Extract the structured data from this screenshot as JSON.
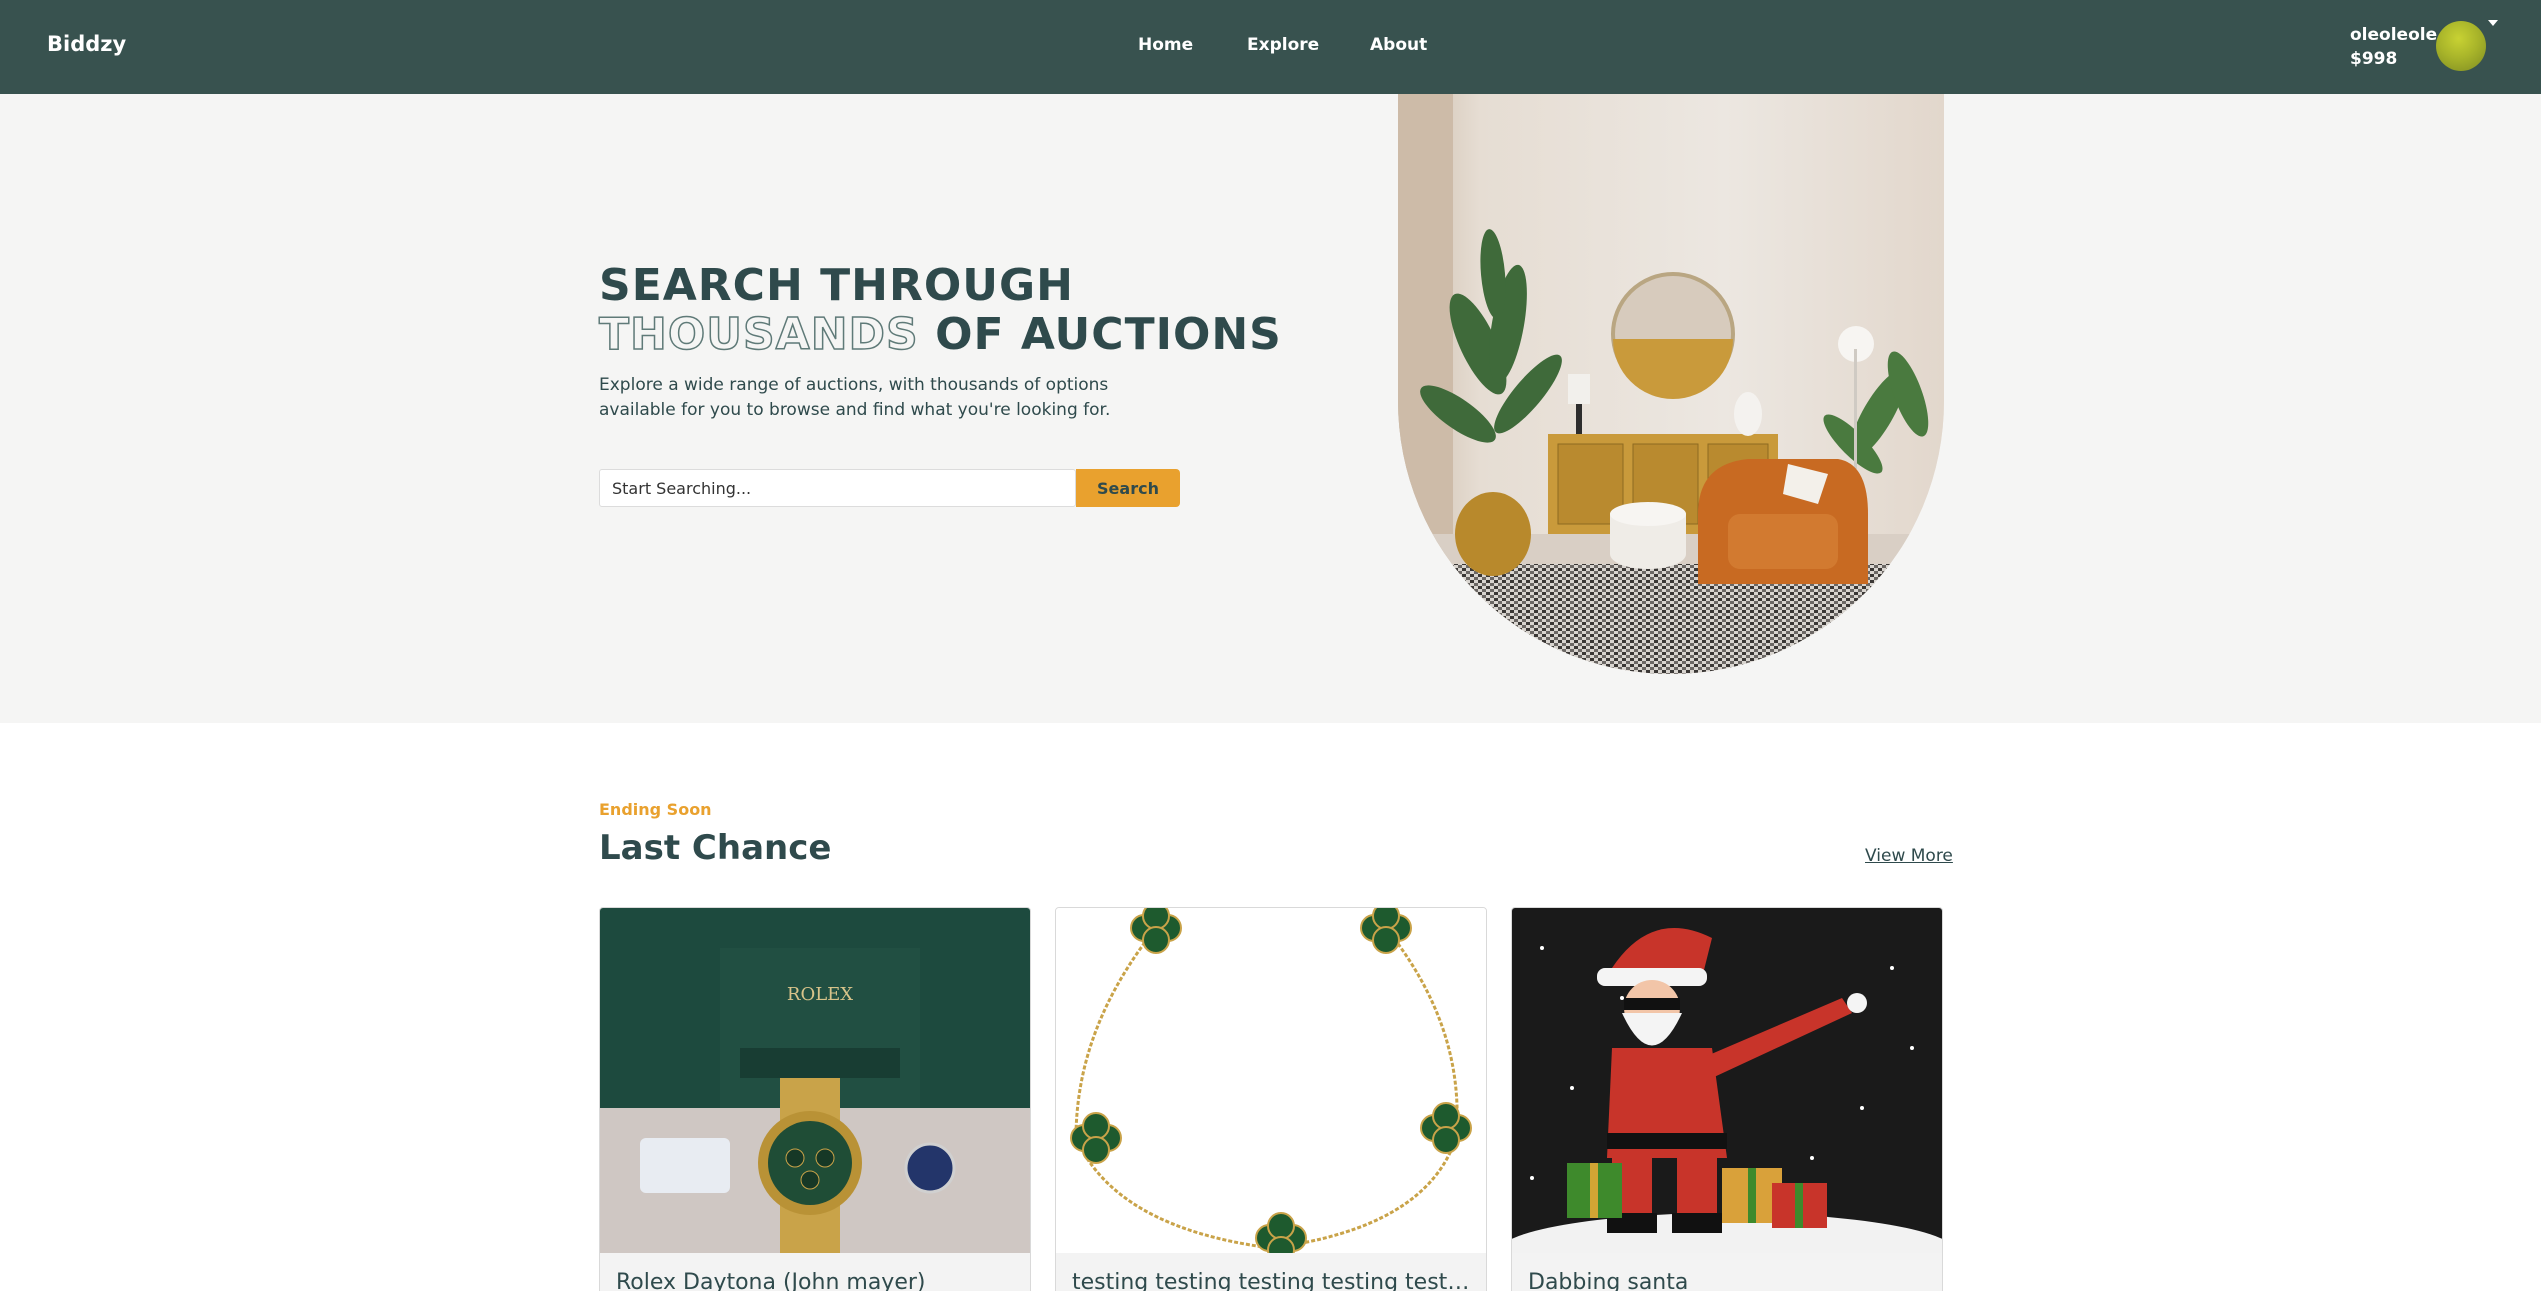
{
  "nav": {
    "brand": "Biddzy",
    "links": [
      "Home",
      "Explore",
      "About"
    ],
    "username": "oleoleole",
    "balance": "$998"
  },
  "hero": {
    "title_line1": "SEARCH THROUGH",
    "title_outline": "THOUSANDS",
    "title_line2_rest": " OF AUCTIONS",
    "description": "Explore a wide range of auctions, with thousands of options available for you to browse and find what you're looking for.",
    "search_placeholder": "Start Searching...",
    "search_button": "Search"
  },
  "section": {
    "kicker": "Ending Soon",
    "title": "Last Chance",
    "view_more": "View More"
  },
  "cards": [
    {
      "title": "Rolex Daytona (John mayer)",
      "image": "rolex-watch-image"
    },
    {
      "title": "testing testing testing testing testing testing",
      "image": "green-clover-bracelet-image"
    },
    {
      "title": "Dabbing santa",
      "image": "dabbing-santa-image"
    }
  ],
  "colors": {
    "navbar": "#38524f",
    "accent": "#e9a12e",
    "text": "#2f4a4c",
    "hero_bg": "#f5f5f4"
  }
}
